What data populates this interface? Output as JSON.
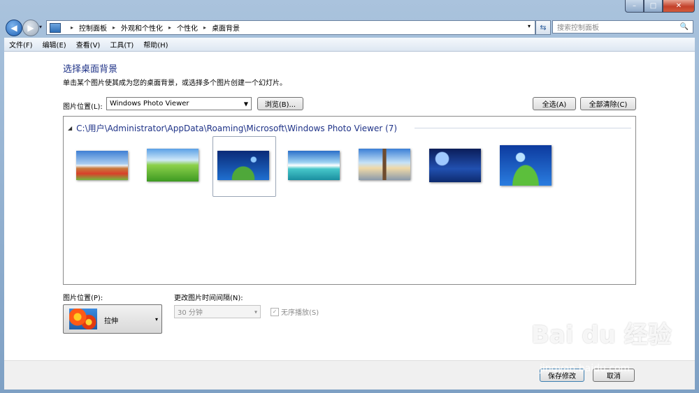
{
  "window": {
    "minimize": "–",
    "maximize": "□",
    "close": "✕"
  },
  "nav": {
    "back_icon": "back-arrow-icon",
    "forward_icon": "forward-arrow-icon",
    "recent": "▾"
  },
  "address": {
    "crumbs": [
      "控制面板",
      "外观和个性化",
      "个性化",
      "桌面背景"
    ],
    "separator": "▸",
    "dropdown": "▾",
    "refresh": "⇆"
  },
  "search": {
    "placeholder": "搜索控制面板",
    "icon": "🔍"
  },
  "menu": [
    "文件(F)",
    "编辑(E)",
    "查看(V)",
    "工具(T)",
    "帮助(H)"
  ],
  "page": {
    "title": "选择桌面背景",
    "subtitle": "单击某个图片使其成为您的桌面背景，或选择多个图片创建一个幻灯片。",
    "location_label": "图片位置(L):",
    "location_value": "Windows Photo Viewer",
    "browse": "浏览(B)...",
    "select_all": "全选(A)",
    "clear_all": "全部清除(C)"
  },
  "gallery": {
    "chevron": "◢",
    "group_title": "C:\\用户\\Administrator\\AppData\\Roaming\\Microsoft\\Windows Photo Viewer (7)",
    "selected_index": 2,
    "image_count": 7
  },
  "position": {
    "label": "图片位置(P):",
    "value": "拉伸",
    "arrow": "▾"
  },
  "interval": {
    "label": "更改图片时间间隔(N):",
    "value": "30 分钟",
    "arrow": "▾"
  },
  "shuffle": {
    "label": "无序播放(S)",
    "checked": true
  },
  "footer": {
    "save": "保存修改",
    "cancel": "取消"
  },
  "watermark": {
    "logo": "Bai du 经验",
    "url": "jingyan.baidu.com"
  }
}
